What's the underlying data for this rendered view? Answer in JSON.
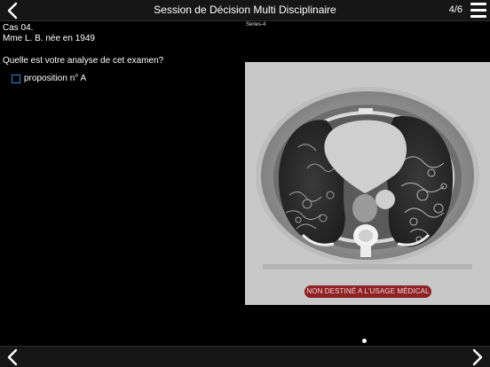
{
  "header": {
    "title": "Session de Décision Multi Disciplinaire",
    "counter": "4/6",
    "back_icon": "chevron-left-icon",
    "menu_icon": "hamburger-menu-icon"
  },
  "case": {
    "number": "Cas 04.",
    "patient": "Mme L. B. née en 1949"
  },
  "question": {
    "text": "Quelle est votre analyse de cet examen?",
    "options": [
      {
        "label": "proposition n° A",
        "checked": false
      }
    ]
  },
  "viewer": {
    "series_label": "Series-4",
    "watermark": "NON DESTINÉ A L'USAGE MÉDICAL"
  },
  "pagination": {
    "total_dots": 1,
    "active_dot": 1
  },
  "footer": {
    "prev_icon": "chevron-left-icon",
    "next_icon": "chevron-right-icon"
  },
  "colors": {
    "background": "#000000",
    "bar": "#161616",
    "accent_blue": "#2f86d6",
    "watermark_red": "#8e2326"
  }
}
